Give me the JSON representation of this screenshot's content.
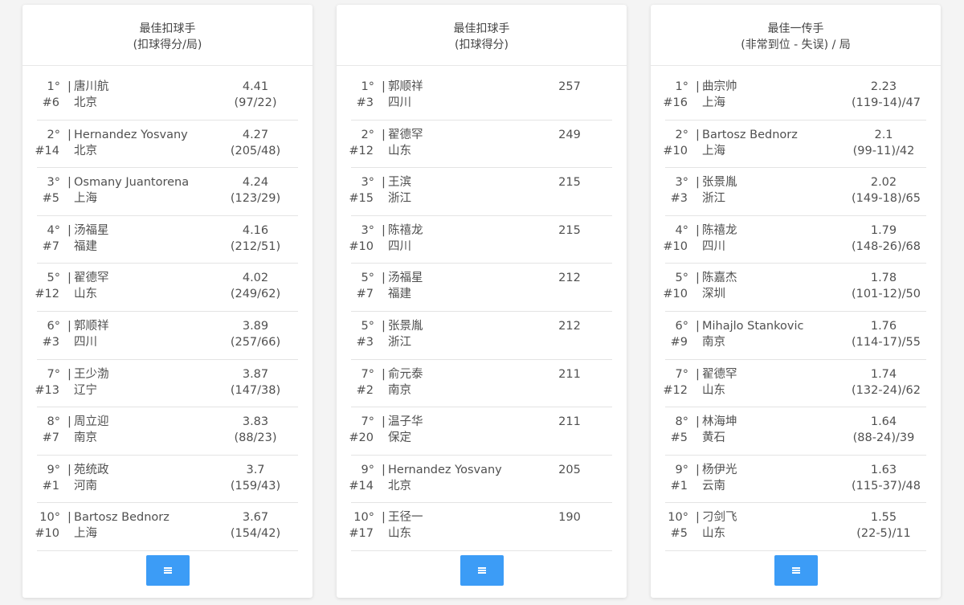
{
  "boards": [
    {
      "title": "最佳扣球手",
      "subtitle": "(扣球得分/局)",
      "more_icon": "menu-icon",
      "rows": [
        {
          "rank": "1°",
          "sep": "|",
          "name": "唐川航",
          "number": "#6",
          "team": "北京",
          "value": "4.41",
          "detail": "(97/22)"
        },
        {
          "rank": "2°",
          "sep": "|",
          "name": "Hernandez Yosvany",
          "number": "#14",
          "team": "北京",
          "value": "4.27",
          "detail": "(205/48)"
        },
        {
          "rank": "3°",
          "sep": "|",
          "name": "Osmany Juantorena",
          "number": "#5",
          "team": "上海",
          "value": "4.24",
          "detail": "(123/29)"
        },
        {
          "rank": "4°",
          "sep": "|",
          "name": "汤福星",
          "number": "#7",
          "team": "福建",
          "value": "4.16",
          "detail": "(212/51)"
        },
        {
          "rank": "5°",
          "sep": "|",
          "name": "翟德罕",
          "number": "#12",
          "team": "山东",
          "value": "4.02",
          "detail": "(249/62)"
        },
        {
          "rank": "6°",
          "sep": "|",
          "name": "郭顺祥",
          "number": "#3",
          "team": "四川",
          "value": "3.89",
          "detail": "(257/66)"
        },
        {
          "rank": "7°",
          "sep": "|",
          "name": "王少渤",
          "number": "#13",
          "team": "辽宁",
          "value": "3.87",
          "detail": "(147/38)"
        },
        {
          "rank": "8°",
          "sep": "|",
          "name": "周立迎",
          "number": "#7",
          "team": "南京",
          "value": "3.83",
          "detail": "(88/23)"
        },
        {
          "rank": "9°",
          "sep": "|",
          "name": "苑统政",
          "number": "#1",
          "team": "河南",
          "value": "3.7",
          "detail": "(159/43)"
        },
        {
          "rank": "10°",
          "sep": "|",
          "name": "Bartosz Bednorz",
          "number": "#10",
          "team": "上海",
          "value": "3.67",
          "detail": "(154/42)"
        }
      ]
    },
    {
      "title": "最佳扣球手",
      "subtitle": "(扣球得分)",
      "more_icon": "menu-icon",
      "rows": [
        {
          "rank": "1°",
          "sep": "|",
          "name": "郭顺祥",
          "number": "#3",
          "team": "四川",
          "value": "257",
          "detail": ""
        },
        {
          "rank": "2°",
          "sep": "|",
          "name": "翟德罕",
          "number": "#12",
          "team": "山东",
          "value": "249",
          "detail": ""
        },
        {
          "rank": "3°",
          "sep": "|",
          "name": "王滨",
          "number": "#15",
          "team": "浙江",
          "value": "215",
          "detail": ""
        },
        {
          "rank": "3°",
          "sep": "|",
          "name": "陈禧龙",
          "number": "#10",
          "team": "四川",
          "value": "215",
          "detail": ""
        },
        {
          "rank": "5°",
          "sep": "|",
          "name": "汤福星",
          "number": "#7",
          "team": "福建",
          "value": "212",
          "detail": ""
        },
        {
          "rank": "5°",
          "sep": "|",
          "name": "张景胤",
          "number": "#3",
          "team": "浙江",
          "value": "212",
          "detail": ""
        },
        {
          "rank": "7°",
          "sep": "|",
          "name": "俞元泰",
          "number": "#2",
          "team": "南京",
          "value": "211",
          "detail": ""
        },
        {
          "rank": "7°",
          "sep": "|",
          "name": "温子华",
          "number": "#20",
          "team": "保定",
          "value": "211",
          "detail": ""
        },
        {
          "rank": "9°",
          "sep": "|",
          "name": "Hernandez Yosvany",
          "number": "#14",
          "team": "北京",
          "value": "205",
          "detail": ""
        },
        {
          "rank": "10°",
          "sep": "|",
          "name": "王径一",
          "number": "#17",
          "team": "山东",
          "value": "190",
          "detail": ""
        }
      ]
    },
    {
      "title": "最佳一传手",
      "subtitle": "(非常到位 - 失误) / 局",
      "more_icon": "menu-icon",
      "rows": [
        {
          "rank": "1°",
          "sep": "|",
          "name": "曲宗帅",
          "number": "#16",
          "team": "上海",
          "value": "2.23",
          "detail": "(119-14)/47"
        },
        {
          "rank": "2°",
          "sep": "|",
          "name": "Bartosz Bednorz",
          "number": "#10",
          "team": "上海",
          "value": "2.1",
          "detail": "(99-11)/42"
        },
        {
          "rank": "3°",
          "sep": "|",
          "name": "张景胤",
          "number": "#3",
          "team": "浙江",
          "value": "2.02",
          "detail": "(149-18)/65"
        },
        {
          "rank": "4°",
          "sep": "|",
          "name": "陈禧龙",
          "number": "#10",
          "team": "四川",
          "value": "1.79",
          "detail": "(148-26)/68"
        },
        {
          "rank": "5°",
          "sep": "|",
          "name": "陈嘉杰",
          "number": "#10",
          "team": "深圳",
          "value": "1.78",
          "detail": "(101-12)/50"
        },
        {
          "rank": "6°",
          "sep": "|",
          "name": "Mihajlo Stankovic",
          "number": "#9",
          "team": "南京",
          "value": "1.76",
          "detail": "(114-17)/55"
        },
        {
          "rank": "7°",
          "sep": "|",
          "name": "翟德罕",
          "number": "#12",
          "team": "山东",
          "value": "1.74",
          "detail": "(132-24)/62"
        },
        {
          "rank": "8°",
          "sep": "|",
          "name": "林海坤",
          "number": "#5",
          "team": "黄石",
          "value": "1.64",
          "detail": "(88-24)/39"
        },
        {
          "rank": "9°",
          "sep": "|",
          "name": "杨伊光",
          "number": "#1",
          "team": "云南",
          "value": "1.63",
          "detail": "(115-37)/48"
        },
        {
          "rank": "10°",
          "sep": "|",
          "name": "刁剑飞",
          "number": "#5",
          "team": "山东",
          "value": "1.55",
          "detail": "(22-5)/11"
        }
      ]
    }
  ],
  "colors": {
    "button": "#3c9cf6",
    "text": "#505050",
    "divider": "#e4e4e4",
    "background": "#f4f4f4"
  }
}
